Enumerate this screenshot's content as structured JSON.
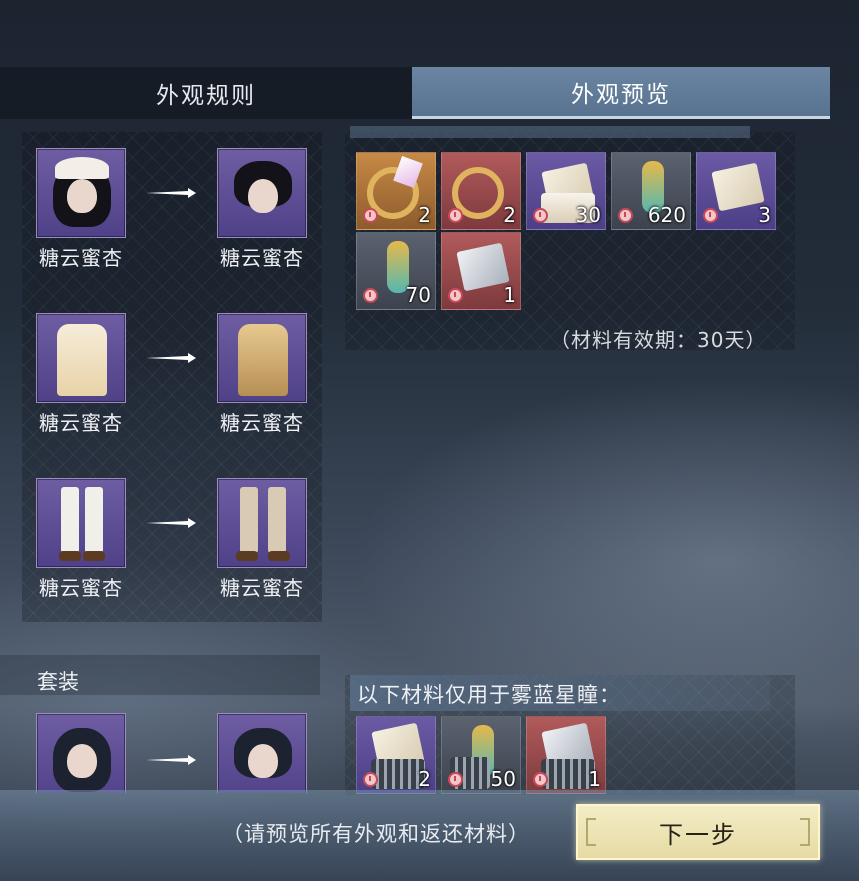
{
  "tabs": [
    {
      "label": "外观规则",
      "active": false
    },
    {
      "label": "外观预览",
      "active": true
    }
  ],
  "conversions": [
    {
      "from_label": "糖云蜜杏",
      "to_label": "糖云蜜杏",
      "type": "head"
    },
    {
      "from_label": "糖云蜜杏",
      "to_label": "糖云蜜杏",
      "type": "outfit"
    },
    {
      "from_label": "糖云蜜杏",
      "to_label": "糖云蜜杏",
      "type": "pants"
    }
  ],
  "materials_panel": {
    "items": [
      {
        "quantity": "2",
        "rarity": "orange",
        "icon": "ring-headpiece-icon"
      },
      {
        "quantity": "2",
        "rarity": "red",
        "icon": "ring-headpiece-icon"
      },
      {
        "quantity": "30",
        "rarity": "purple",
        "icon": "cloth-material-icon"
      },
      {
        "quantity": "620",
        "rarity": "gray",
        "icon": "dye-bottle-icon"
      },
      {
        "quantity": "3",
        "rarity": "purple",
        "icon": "cloth-material-icon"
      },
      {
        "quantity": "70",
        "rarity": "gray",
        "icon": "dye-bottle-icon"
      },
      {
        "quantity": "1",
        "rarity": "red",
        "icon": "cloth-material-icon"
      }
    ],
    "validity_text": "（材料有效期：30天）"
  },
  "suit_section": {
    "title": "套装",
    "note": "以下材料仅用于雾蓝星瞳：",
    "items": [
      {
        "quantity": "2",
        "rarity": "purple",
        "icon": "cloth-material-icon"
      },
      {
        "quantity": "50",
        "rarity": "gray",
        "icon": "dye-bottle-icon"
      },
      {
        "quantity": "1",
        "rarity": "red",
        "icon": "cloth-material-icon"
      }
    ]
  },
  "footer": {
    "hint": "（请预览所有外观和返还材料）",
    "next_label": "下一步"
  },
  "colors": {
    "tab_active": "#6a86a3",
    "slot_purple": "#6e5da3",
    "rarity_orange": "#c78a46",
    "rarity_red": "#b15a5b",
    "next_button": "#f3edc7"
  }
}
